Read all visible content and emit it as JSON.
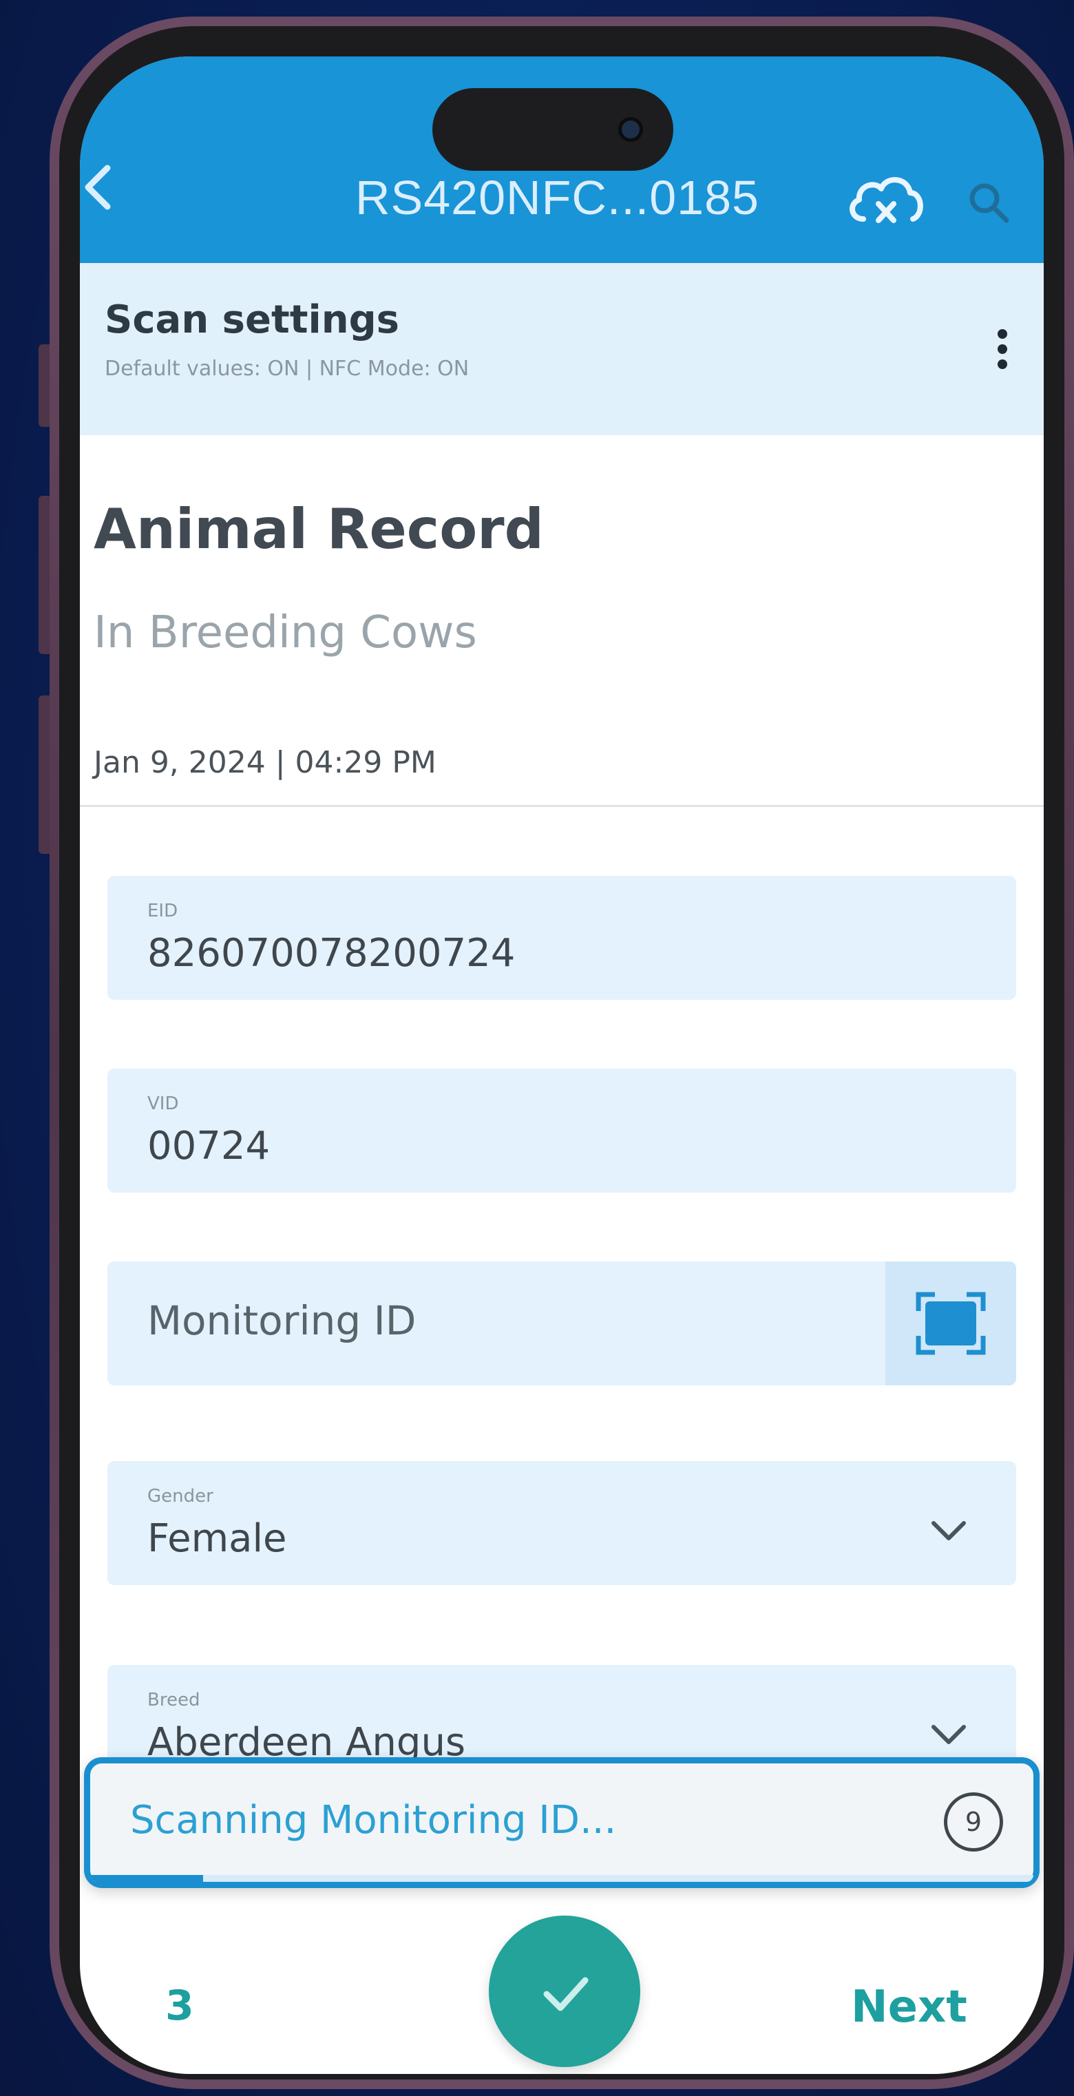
{
  "header": {
    "title": "RS420NFC...0185",
    "back_icon": "chevron-left-icon",
    "cloud_icon": "cloud-off-icon",
    "search_icon": "search-icon",
    "color": "#1994d6"
  },
  "scan_settings": {
    "title": "Scan settings",
    "subtitle": "Default values: ON | NFC Mode: ON",
    "menu_icon": "more-vertical-icon"
  },
  "record": {
    "title": "Animal Record",
    "subtitle": "In Breeding Cows",
    "datetime": "Jan 9, 2024 | 04:29 PM"
  },
  "fields": {
    "eid": {
      "label": "EID",
      "value": "826070078200724"
    },
    "vid": {
      "label": "VID",
      "value": "00724"
    },
    "monitoring": {
      "placeholder": "Monitoring ID",
      "icon": "scan-icon"
    },
    "gender": {
      "label": "Gender",
      "value": "Female",
      "icon": "chevron-down-icon"
    },
    "breed": {
      "label": "Breed",
      "value": "Aberdeen Angus",
      "icon": "chevron-down-icon"
    }
  },
  "scanning": {
    "text": "Scanning Monitoring ID...",
    "countdown": "9",
    "progress": 0.12,
    "accent": "#1a8fcf"
  },
  "bottom_bar": {
    "count": "3",
    "confirm_icon": "check-icon",
    "next_label": "Next",
    "accent": "#23a39a"
  }
}
